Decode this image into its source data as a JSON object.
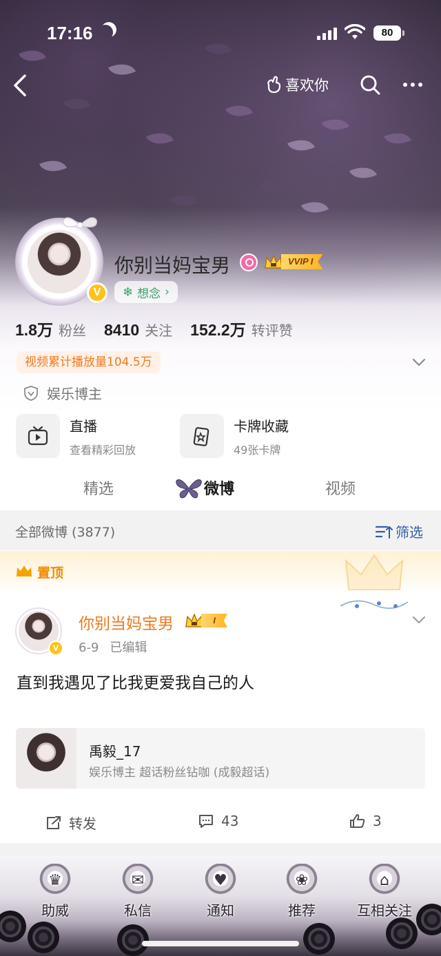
{
  "status_bar": {
    "time": "17:16",
    "battery": "80"
  },
  "nav": {
    "like_label": "喜欢你"
  },
  "profile": {
    "name": "你别当妈宝男",
    "vip_label": "VVIP I",
    "mood": "想念",
    "stats": [
      {
        "value": "1.8万",
        "label": "粉丝"
      },
      {
        "value": "8410",
        "label": "关注"
      },
      {
        "value": "152.2万",
        "label": "转评赞"
      }
    ],
    "play_count": "视频累计播放量104.5万",
    "category": "娱乐博主"
  },
  "cards": [
    {
      "title": "直播",
      "subtitle": "查看精彩回放",
      "icon": "tv-icon"
    },
    {
      "title": "卡牌收藏",
      "subtitle": "49张卡牌",
      "icon": "card-icon"
    }
  ],
  "tabs": [
    {
      "label": "精选"
    },
    {
      "label": "微博",
      "selected": true
    },
    {
      "label": "视频"
    }
  ],
  "filter_bar": {
    "all_label": "全部微博 (3877)",
    "filter_label": "筛选"
  },
  "post": {
    "pinned_label": "置顶",
    "author": "你别当妈宝男",
    "level": "I",
    "date": "6-9",
    "edited": "已编辑",
    "text": "直到我遇见了比我更爱我自己的人",
    "share_card": {
      "name": "禹毅_17",
      "desc": "娱乐博主 超话粉丝钻咖 (成毅超话)"
    },
    "actions": {
      "repost": "转发",
      "comments": "43",
      "likes": "3"
    }
  },
  "bottom_nav": [
    {
      "label": "助威"
    },
    {
      "label": "私信"
    },
    {
      "label": "通知"
    },
    {
      "label": "推荐"
    },
    {
      "label": "互相关注"
    }
  ],
  "colors": {
    "accent_orange": "#f07a1e",
    "link_blue": "#2f5fa8",
    "mood_green": "#3aa06a",
    "vip_gold": "#ffb425"
  }
}
